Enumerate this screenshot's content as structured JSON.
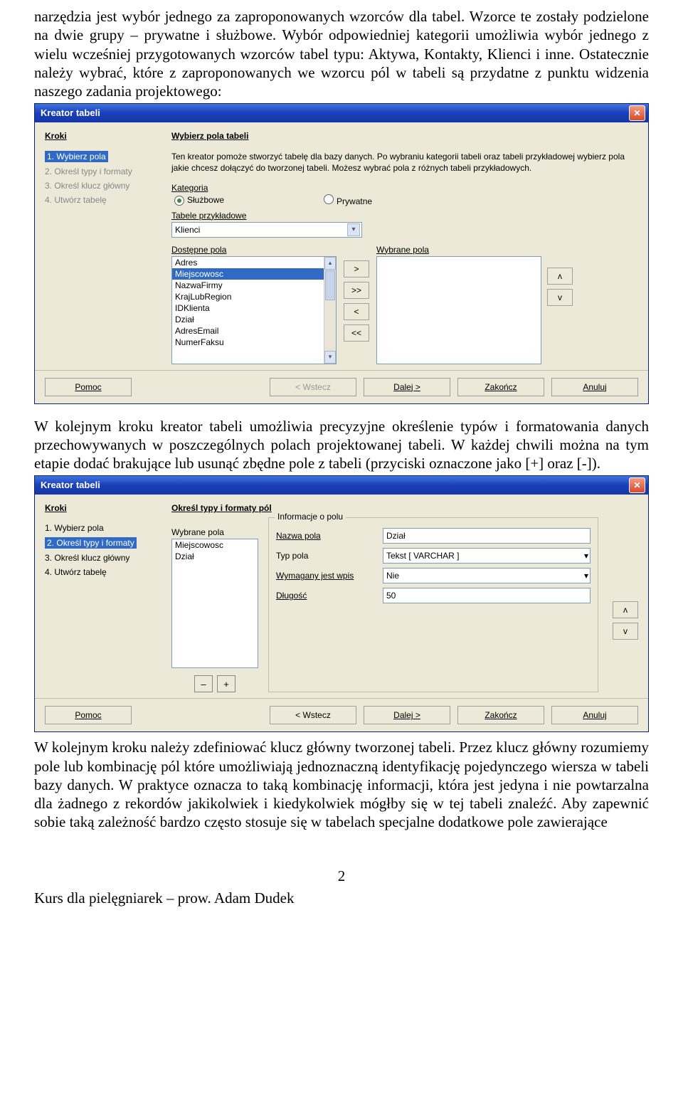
{
  "paragraphs": {
    "p1": "narzędzia jest wybór jednego za zaproponowanych wzorców dla tabel. Wzorce te zostały podzielone na dwie grupy – prywatne i służbowe. Wybór odpowiedniej kategorii umożliwia wybór jednego z wielu wcześniej przygotowanych wzorców tabel typu: Aktywa, Kontakty, Klienci i inne. Ostatecznie należy wybrać, które z zaproponowanych we wzorcu pól w tabeli są przydatne z punktu widzenia naszego zadania projektowego:",
    "p2": "W kolejnym kroku kreator tabeli umożliwia precyzyjne określenie typów i formatowania danych przechowywanych w poszczególnych polach projektowanej tabeli. W każdej chwili można na tym etapie dodać brakujące lub usunąć zbędne pole z tabeli (przyciski oznaczone jako [+] oraz [-]).",
    "p3": "W kolejnym kroku należy zdefiniować klucz główny tworzonej tabeli. Przez klucz główny rozumiemy pole lub kombinację pól które umożliwiają jednoznaczną identyfikację pojedynczego wiersza w tabeli bazy danych. W praktyce oznacza to taką kombinację informacji, która jest jedyna i nie powtarzalna dla żadnego z rekordów jakikolwiek i kiedykolwiek mógłby się w tej tabeli znaleźć. Aby zapewnić sobie taką zależność bardzo często stosuje się w tabelach specjalne dodatkowe pole zawierające"
  },
  "dialog1": {
    "title": "Kreator tabeli",
    "steps_header": "Kroki",
    "main_header": "Wybierz pola tabeli",
    "help": "Ten kreator pomoże stworzyć tabelę dla bazy danych. Po wybraniu kategorii tabeli oraz tabeli przykładowej wybierz pola jakie chcesz dołączyć do tworzonej tabeli. Możesz wybrać pola z różnych tabeli przykładowych.",
    "steps": [
      {
        "num": "1.",
        "label": "Wybierz pola",
        "state": "active"
      },
      {
        "num": "2.",
        "label": "Określ typy i formaty",
        "state": "disabled"
      },
      {
        "num": "3.",
        "label": "Określ klucz główny",
        "state": "disabled"
      },
      {
        "num": "4.",
        "label": "Utwórz tabelę",
        "state": "disabled"
      }
    ],
    "category_label": "Kategoria",
    "category_opts": {
      "a": "Służbowe",
      "b": "Prywatne"
    },
    "sample_label": "Tabele przykładowe",
    "sample_value": "Klienci",
    "avail_label": "Dostępne pola",
    "sel_label": "Wybrane pola",
    "avail_items": [
      "Adres",
      "Miejscowosc",
      "NazwaFirmy",
      "KrajLubRegion",
      "IDKlienta",
      "Dział",
      "AdresEmail",
      "NumerFaksu"
    ],
    "move": {
      "r": ">",
      "rr": ">>",
      "l": "<",
      "ll": "<<"
    },
    "updown": {
      "u": "ʌ",
      "d": "v"
    },
    "buttons": {
      "help": "Pomoc",
      "back": "< Wstecz",
      "next": "Dalej >",
      "finish": "Zakończ",
      "cancel": "Anuluj"
    }
  },
  "dialog2": {
    "title": "Kreator tabeli",
    "steps_header": "Kroki",
    "main_header": "Określ typy i formaty pól",
    "steps": [
      {
        "num": "1.",
        "label": "Wybierz pola",
        "state": "normal"
      },
      {
        "num": "2.",
        "label": "Określ typy i formaty",
        "state": "active"
      },
      {
        "num": "3.",
        "label": "Określ klucz główny",
        "state": "normal"
      },
      {
        "num": "4.",
        "label": "Utwórz tabelę",
        "state": "normal"
      }
    ],
    "sel_label": "Wybrane pola",
    "sel_items": [
      "Miejscowosc",
      "Dział"
    ],
    "fieldset_label": "Informacje o polu",
    "rows": {
      "name": {
        "label": "Nazwa pola",
        "value": "Dział"
      },
      "type": {
        "label": "Typ pola",
        "value": "Tekst [ VARCHAR ]"
      },
      "req": {
        "label": "Wymagany jest wpis",
        "value": "Nie"
      },
      "len": {
        "label": "Długość",
        "value": "50"
      }
    },
    "updown": {
      "u": "ʌ",
      "d": "v"
    },
    "pm": {
      "minus": "–",
      "plus": "+"
    },
    "buttons": {
      "help": "Pomoc",
      "back": "< Wstecz",
      "next": "Dalej >",
      "finish": "Zakończ",
      "cancel": "Anuluj"
    }
  },
  "footer": {
    "page": "2",
    "line": "Kurs dla pielęgniarek – prow. Adam Dudek"
  }
}
